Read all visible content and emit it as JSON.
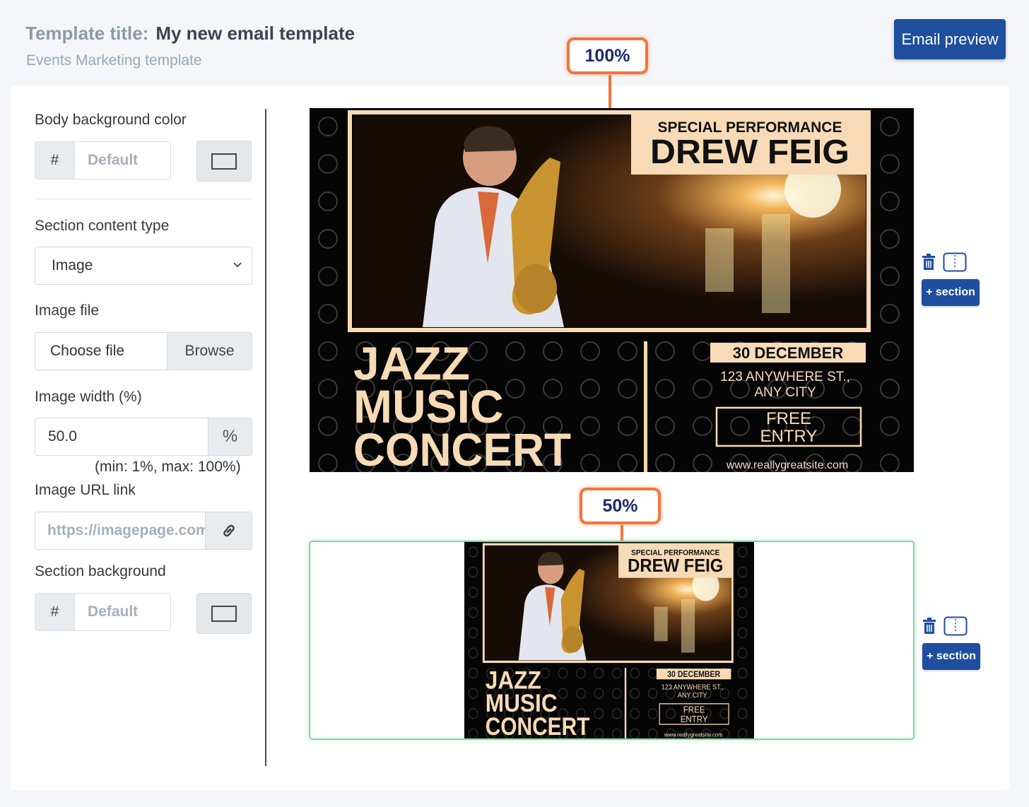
{
  "header": {
    "title_label": "Template title:",
    "title_value": "My new email template",
    "subtitle": "Events Marketing template",
    "preview_button": "Email preview"
  },
  "settings": {
    "body_bg_label": "Body background color",
    "hash": "#",
    "default_placeholder": "Default",
    "section_type_label": "Section content type",
    "section_type_value": "Image",
    "image_file_label": "Image file",
    "choose_file": "Choose file",
    "browse": "Browse",
    "image_width_label": "Image width (%)",
    "image_width_value": "50.0",
    "percent_symbol": "%",
    "min_max": "(min: 1%, max: 100%)",
    "url_label": "Image URL link",
    "url_placeholder": "https://imagepage.com",
    "section_bg_label": "Section background"
  },
  "callouts": {
    "full": "100%",
    "half": "50%"
  },
  "poster": {
    "special": "SPECIAL PERFORMANCE",
    "name": "DREW FEIG",
    "line1": "JAZZ",
    "line2": "MUSIC",
    "line3": "CONCERT",
    "date": "30 DECEMBER",
    "address1": "123 ANYWHERE ST.,",
    "address2": "ANY CITY",
    "free1": "FREE",
    "free2": "ENTRY",
    "website": "www.reallygreatsite.com"
  },
  "section_tools": {
    "add_section": "+ section",
    "trash_icon": "trash-icon",
    "split_icon": "split-column-icon"
  },
  "colors": {
    "accent": "#1f4e9e",
    "callout": "#f5733a",
    "selected_border": "#7fd8a4",
    "poster_cream": "#f7dbb6"
  }
}
